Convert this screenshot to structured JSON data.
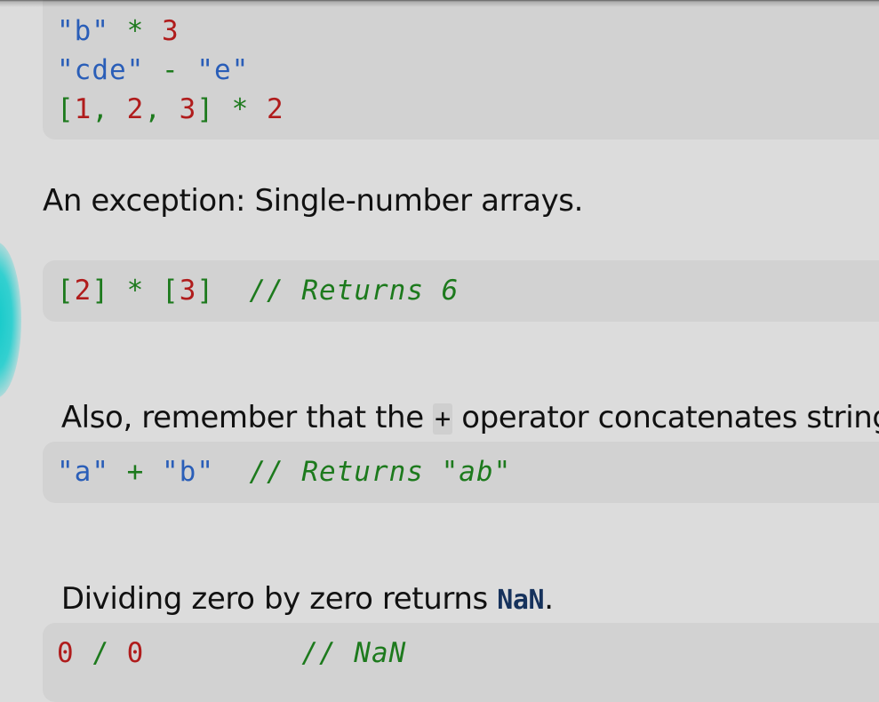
{
  "block1": {
    "line1": [
      {
        "t": "\"b\"",
        "c": "str"
      },
      {
        "t": " * ",
        "c": "op"
      },
      {
        "t": "3",
        "c": "num"
      }
    ],
    "line2": [
      {
        "t": "\"cde\"",
        "c": "str"
      },
      {
        "t": " - ",
        "c": "op"
      },
      {
        "t": "\"e\"",
        "c": "str"
      }
    ],
    "line3": [
      {
        "t": "[",
        "c": "br"
      },
      {
        "t": "1",
        "c": "num"
      },
      {
        "t": ", ",
        "c": "br"
      },
      {
        "t": "2",
        "c": "num"
      },
      {
        "t": ", ",
        "c": "br"
      },
      {
        "t": "3",
        "c": "num"
      },
      {
        "t": "]",
        "c": "br"
      },
      {
        "t": " * ",
        "c": "op"
      },
      {
        "t": "2",
        "c": "num"
      }
    ]
  },
  "para1": "An exception: Single-number arrays.",
  "block2": {
    "line1": [
      {
        "t": "[",
        "c": "br"
      },
      {
        "t": "2",
        "c": "num"
      },
      {
        "t": "]",
        "c": "br"
      },
      {
        "t": " * ",
        "c": "op"
      },
      {
        "t": "[",
        "c": "br"
      },
      {
        "t": "3",
        "c": "num"
      },
      {
        "t": "]",
        "c": "br"
      },
      {
        "t": "  // Returns 6",
        "c": "cm"
      }
    ]
  },
  "para2": {
    "before": "Also, remember that the ",
    "code": "+",
    "after": " operator concatenates strings."
  },
  "block3": {
    "line1": [
      {
        "t": "\"a\"",
        "c": "str"
      },
      {
        "t": " + ",
        "c": "op"
      },
      {
        "t": "\"b\"",
        "c": "str"
      },
      {
        "t": "  // Returns \"ab\"",
        "c": "cm"
      }
    ]
  },
  "para3": {
    "before": "Dividing zero by zero returns ",
    "code": "NaN",
    "after": "."
  },
  "block4": {
    "line1": [
      {
        "t": "0",
        "c": "num"
      },
      {
        "t": " / ",
        "c": "op"
      },
      {
        "t": "0",
        "c": "num"
      },
      {
        "t": "         // NaN",
        "c": "cm"
      }
    ]
  },
  "colors": {
    "background": "#dcdcdc",
    "code_background": "#d2d2d2",
    "string": "#2a5eb8",
    "number": "#b01c1c",
    "operator": "#1d7a1d",
    "comment": "#1d7a1d",
    "glow": "#12c9c9"
  }
}
